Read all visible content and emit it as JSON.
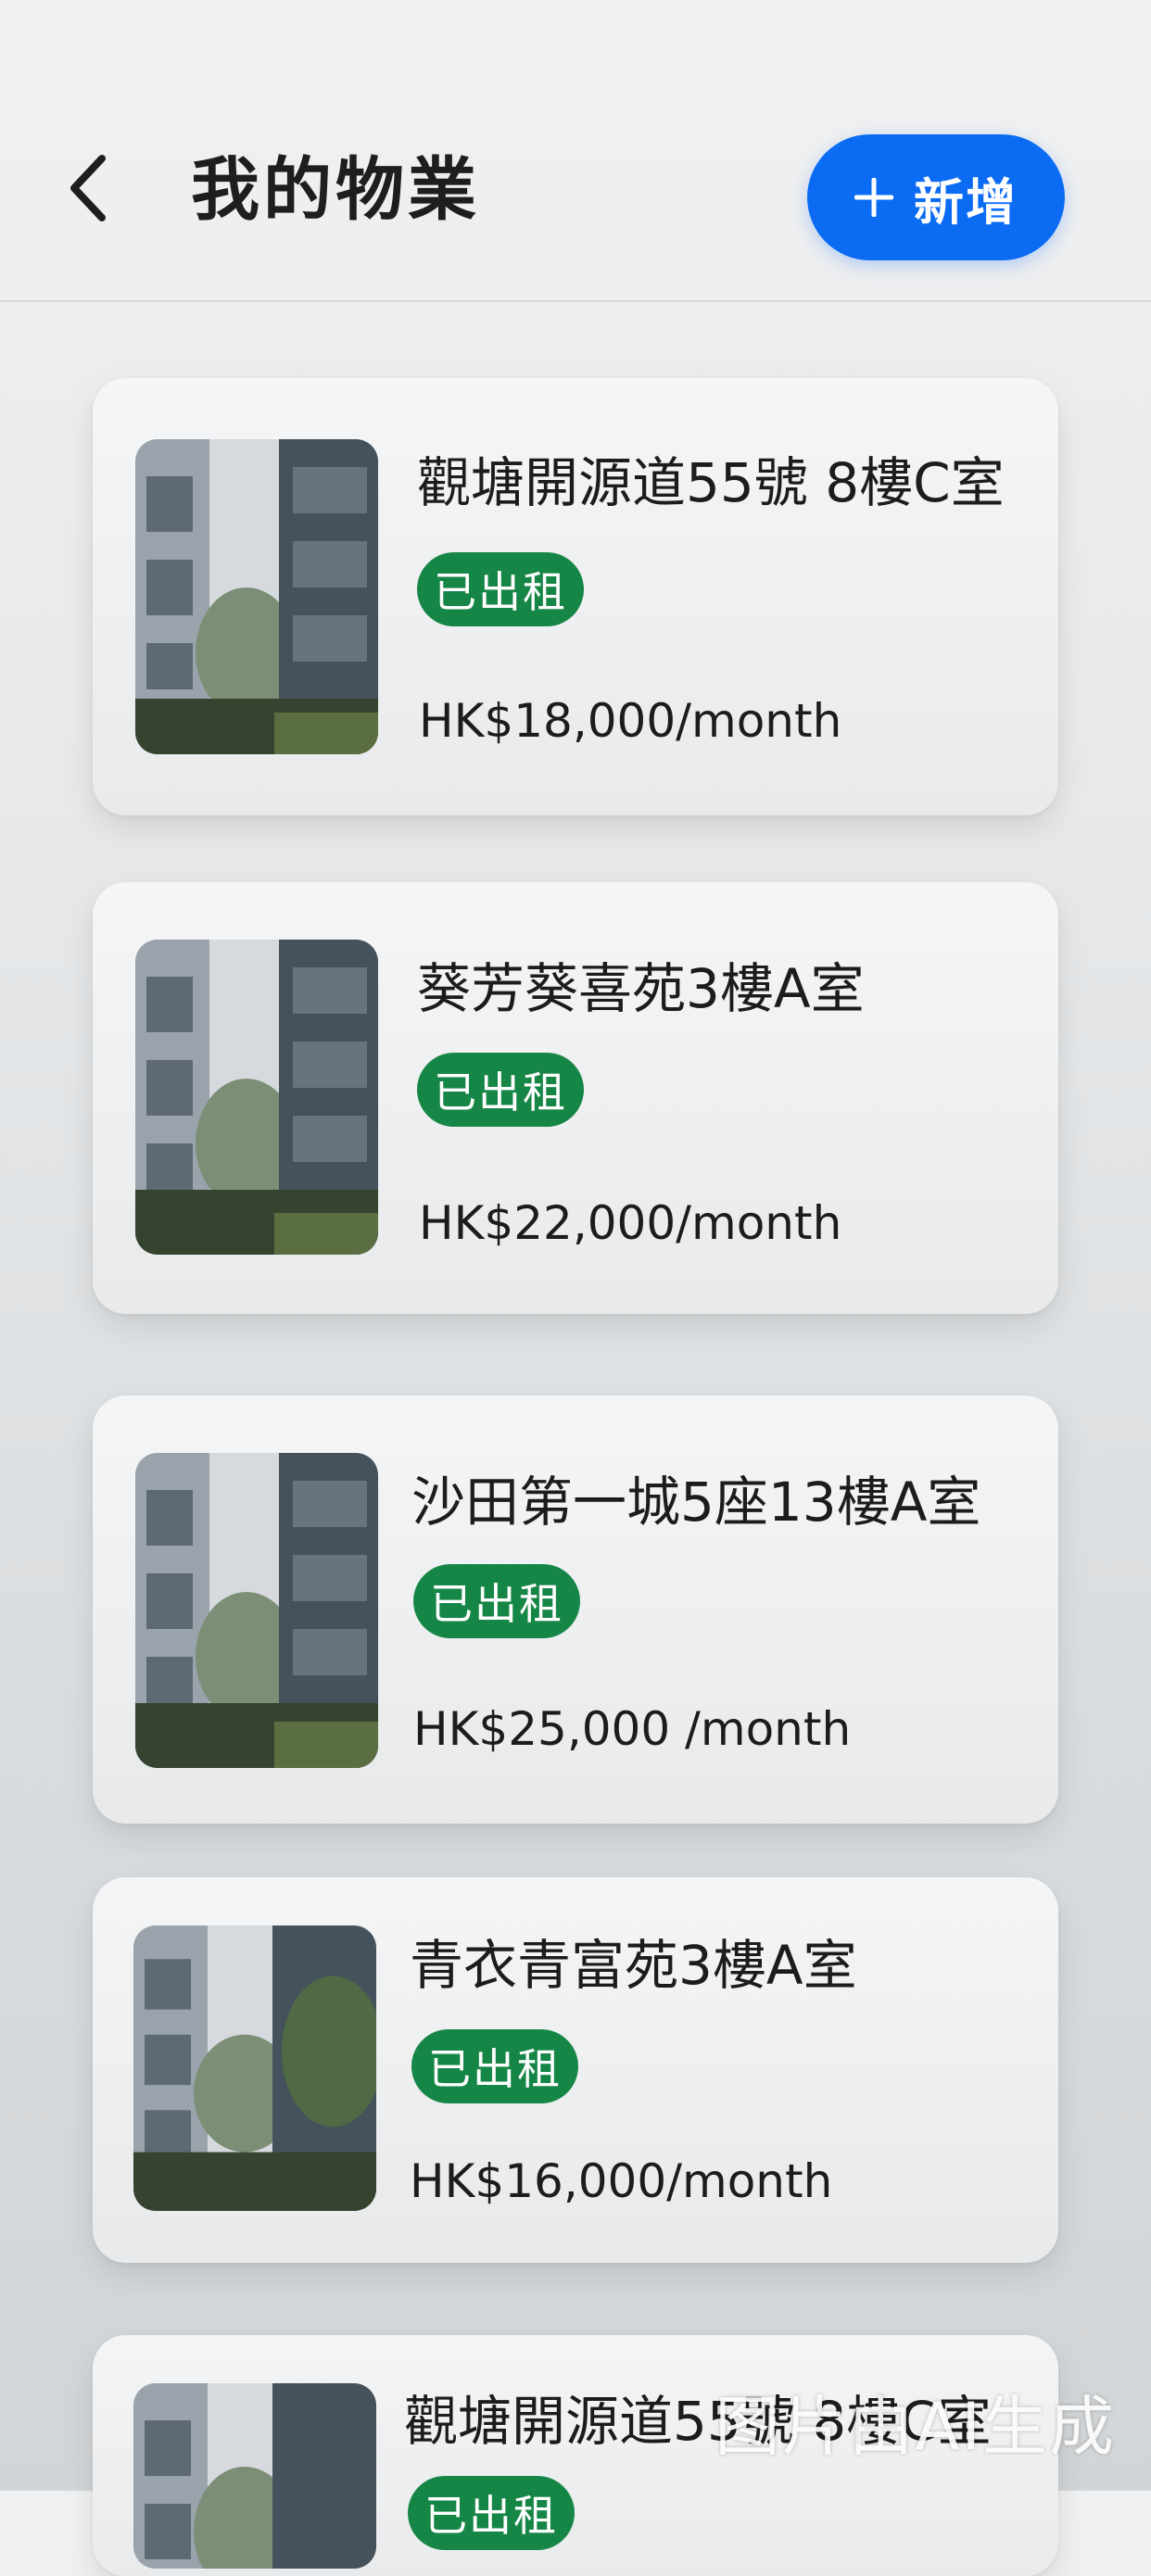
{
  "header": {
    "title": "我的物業",
    "back_icon": "chevron-left-icon",
    "add_button": {
      "icon": "plus-icon",
      "label": "新增",
      "color": "#0b6cf3"
    }
  },
  "properties": [
    {
      "address": "觀塘開源道55號 8樓C室",
      "status": "已出租",
      "price": "HK$18,000/month"
    },
    {
      "address": "葵芳葵喜苑3樓A室",
      "status": "已出租",
      "price": "HK$22,000/month"
    },
    {
      "address": "沙田第一城5座13樓A室",
      "status": "已出租",
      "price": "HK$25,000 /month"
    },
    {
      "address": "青衣青富苑3樓A室",
      "status": "已出租",
      "price": "HK$16,000/month"
    },
    {
      "address": "觀塘開源道55號 8樓C室",
      "status": "已出租",
      "price": ""
    }
  ],
  "status_color": "#168646",
  "watermark": "图片由AI生成"
}
